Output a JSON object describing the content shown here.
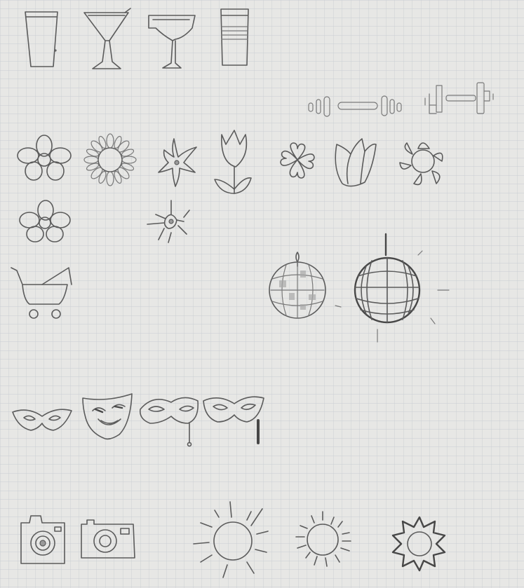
{
  "paper": {
    "background": "#e7e7e5",
    "grid_color": "#c9cdd3",
    "pencil_color": "#5b5b5b"
  },
  "sketch_rows": [
    {
      "row": "drinks",
      "icons": [
        "pint-glass-icon",
        "martini-glass-icon",
        "margarita-glass-icon",
        "striped-highball-glass-icon"
      ]
    },
    {
      "row": "fitness",
      "icons": [
        "dumbbell-outline-icon",
        "dumbbell-blocky-icon"
      ]
    },
    {
      "row": "flowers",
      "icons": [
        "five-petal-flower-icon",
        "daisy-icon",
        "pointed-star-flower-icon",
        "tulip-with-leaves-icon",
        "clover-icon",
        "tulip-bud-icon",
        "sun-flower-icon",
        "five-petal-flower-small-icon",
        "star-burst-flower-icon"
      ]
    },
    {
      "row": "baby-and-party",
      "icons": [
        "baby-stroller-icon",
        "disco-ball-icon",
        "disco-ball-sparkle-icon"
      ]
    },
    {
      "row": "masks",
      "icons": [
        "eye-mask-icon",
        "theater-mask-icon",
        "masquerade-stick-mask-icon",
        "masquerade-handle-mask-icon"
      ]
    },
    {
      "row": "camera-and-sun",
      "icons": [
        "camera-icon",
        "camera-outline-icon",
        "sun-rays-icon",
        "sun-short-rays-icon",
        "sun-pointed-rays-icon"
      ]
    }
  ]
}
